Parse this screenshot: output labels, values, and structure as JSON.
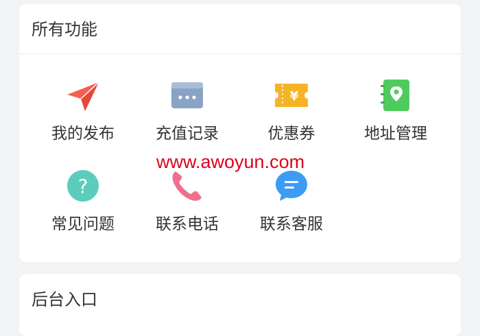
{
  "functions_section": {
    "title": "所有功能",
    "items": [
      {
        "label": "我的发布",
        "icon": "paper-plane-icon"
      },
      {
        "label": "充值记录",
        "icon": "card-icon"
      },
      {
        "label": "优惠券",
        "icon": "coupon-icon"
      },
      {
        "label": "地址管理",
        "icon": "address-book-icon"
      },
      {
        "label": "常见问题",
        "icon": "question-icon"
      },
      {
        "label": "联系电话",
        "icon": "phone-icon"
      },
      {
        "label": "联系客服",
        "icon": "chat-bubble-icon"
      }
    ]
  },
  "backend_section": {
    "title": "后台入口"
  },
  "watermark": "www.awoyun.com",
  "colors": {
    "paper_plane": "#f2604e",
    "card": "#8aa3c4",
    "coupon": "#f5b427",
    "address_book": "#4ecb5c",
    "question": "#5ccdbd",
    "phone": "#ef6f8c",
    "chat_bubble": "#3c9cf4",
    "watermark": "#e0001a"
  }
}
